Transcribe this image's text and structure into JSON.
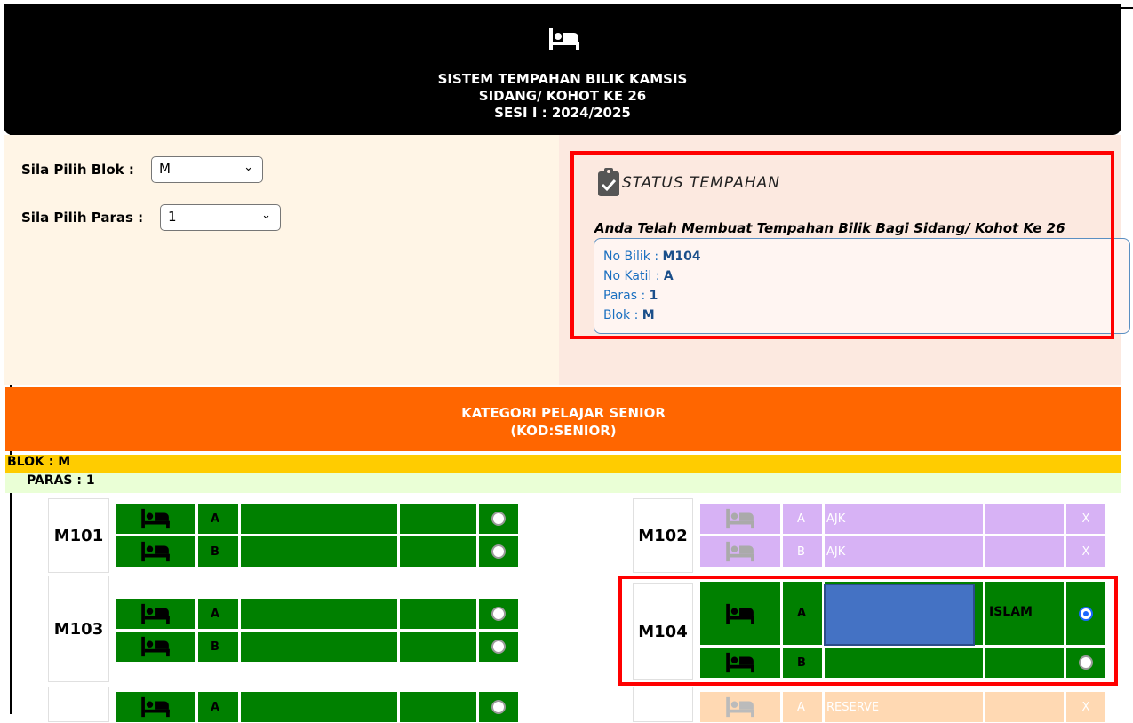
{
  "header": {
    "icon": "bed-icon",
    "line1": "SISTEM TEMPAHAN BILIK KAMSIS",
    "line2": "SIDANG/ KOHOT KE 26",
    "line3": "SESI I : 2024/2025"
  },
  "selectors": {
    "blok_label": "Sila Pilih Blok :",
    "blok_value": "M",
    "paras_label": "Sila Pilih Paras :",
    "paras_value": "1"
  },
  "status": {
    "icon": "clipboard-check-icon",
    "title": "STATUS TEMPAHAN",
    "message": "Anda Telah Membuat Tempahan Bilik Bagi Sidang/ Kohot Ke 26",
    "no_bilik_label": "No Bilik :",
    "no_bilik": "M104",
    "no_katil_label": "No Katil :",
    "no_katil": "A",
    "paras_label": "Paras :",
    "paras": "1",
    "blok_label": "Blok :",
    "blok": "M"
  },
  "category": {
    "line1": "KATEGORI PELAJAR SENIOR",
    "line2": "(KOD:SENIOR)",
    "blok": "BLOK : M",
    "paras": "PARAS : 1"
  },
  "rooms": {
    "m101": {
      "label": "M101",
      "bed_a": "A",
      "bed_b": "B"
    },
    "m102": {
      "label": "M102",
      "bed_a": "A",
      "bed_b": "B",
      "status_a": "AJK",
      "status_b": "AJK",
      "x_a": "X",
      "x_b": "X"
    },
    "m103": {
      "label": "M103",
      "bed_a": "A",
      "bed_b": "B"
    },
    "m104": {
      "label": "M104",
      "bed_a": "A",
      "bed_b": "B",
      "religion_a": "ISLAM"
    },
    "next_right": {
      "bed_a": "A",
      "status_a": "RESERVE",
      "x_a": "X"
    },
    "next_left": {
      "bed_a": "A"
    }
  },
  "colors": {
    "header_bg": "#000000",
    "panel_bg": "#fff5e6",
    "category_bg": "#ff6600",
    "blok_bg": "#ffcc00",
    "paras_bg": "#eaffd6",
    "available": "#008000",
    "ajk": "#d7b2f5",
    "reserve": "#ffd9b3",
    "highlight": "#ff0000"
  }
}
